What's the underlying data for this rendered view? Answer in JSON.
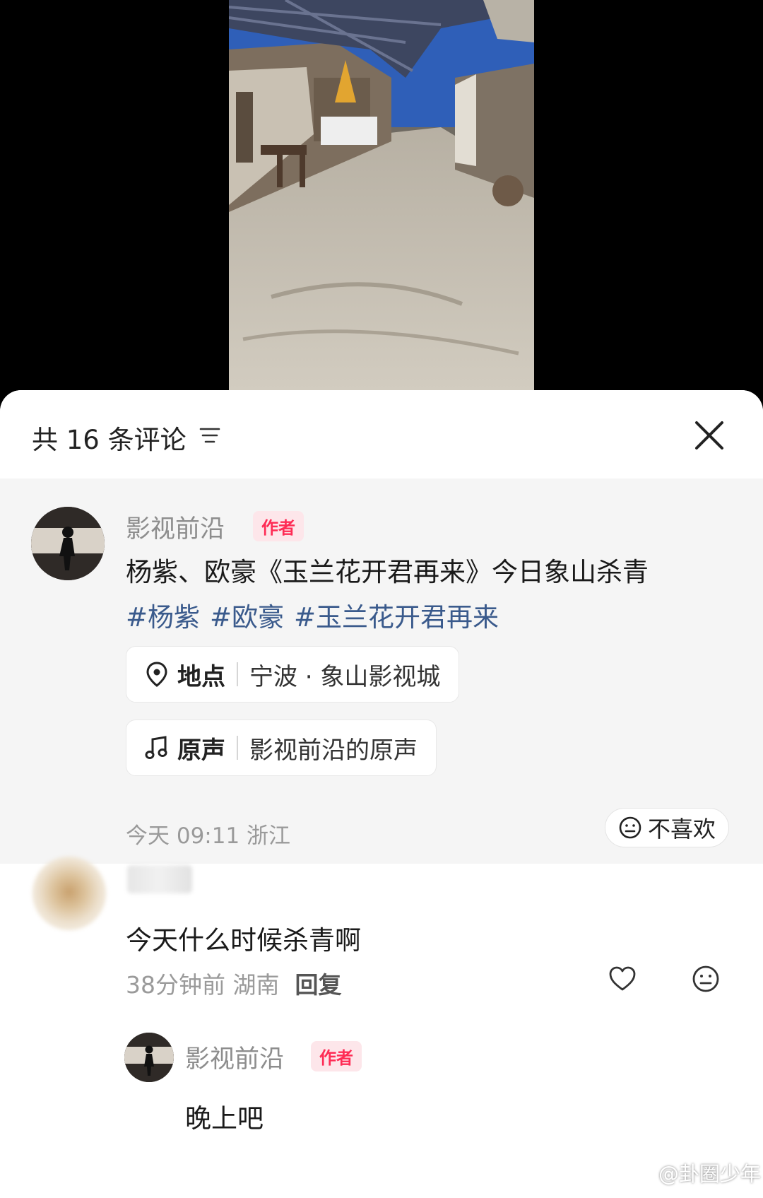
{
  "video": {
    "scene": "film-set-village-street"
  },
  "comments_panel": {
    "count_label": "共 16 条评论",
    "sort_icon": "sort-lines-icon",
    "close_icon": "close-x-icon"
  },
  "author_post": {
    "username": "影视前沿",
    "badge": "作者",
    "text": "杨紫、欧豪《玉兰花开君再来》今日象山杀青",
    "hashtags": [
      "#杨紫",
      "#欧豪",
      "#玉兰花开君再来"
    ],
    "location_label": "地点",
    "location_value": "宁波 · 象山影视城",
    "sound_label": "原声",
    "sound_value": "影视前沿的原声",
    "meta": "今天 09:11 浙江",
    "dislike_label": "不喜欢"
  },
  "comment": {
    "text": "今天什么时候杀青啊",
    "time_location": "38分钟前 湖南",
    "reply_label": "回复",
    "like_icon": "heart-icon",
    "dislike_icon": "neutral-face-icon"
  },
  "nested_reply": {
    "username": "影视前沿",
    "badge": "作者",
    "text": "晚上吧"
  },
  "watermark": {
    "text": "@卦圈少年",
    "icon": "weibo-logo-icon"
  },
  "colors": {
    "badge_red": "#fe2c55",
    "hashtag_blue": "#3a5a8c",
    "meta_gray": "#9a9a9a"
  }
}
